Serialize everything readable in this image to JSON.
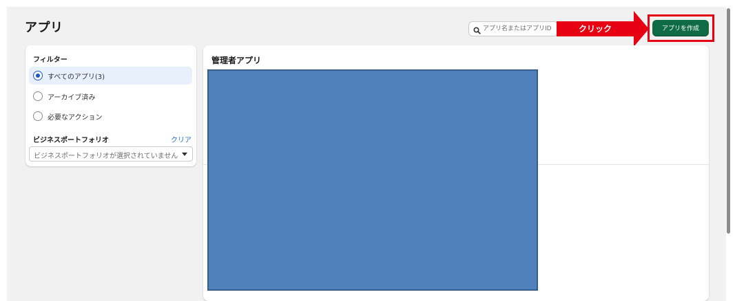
{
  "header": {
    "title": "アプリ",
    "search": {
      "placeholder": "アプリ名またはアプリID",
      "icon": "search-icon"
    },
    "create_app_label": "アプリを作成"
  },
  "annotation": {
    "callout_label": "クリック",
    "color": "#e60012"
  },
  "filters": {
    "heading": "フィルター",
    "options": [
      {
        "label": "すべてのアプリ(3)",
        "selected": true
      },
      {
        "label": "アーカイブ済み",
        "selected": false
      },
      {
        "label": "必要なアクション",
        "selected": false
      }
    ],
    "business_portfolio": {
      "heading": "ビジネスポートフォリオ",
      "clear_label": "クリア",
      "select_value": "ビジネスポートフォリオが選択されていません"
    }
  },
  "main": {
    "heading": "管理者アプリ"
  },
  "colors": {
    "primary_button": "#0f6b45",
    "selected_row": "#e8f0fb",
    "radio_selected": "#1a56c6",
    "link": "#2c6ecb",
    "redaction": "#4f81bd",
    "page_background": "#f1f1f1"
  }
}
